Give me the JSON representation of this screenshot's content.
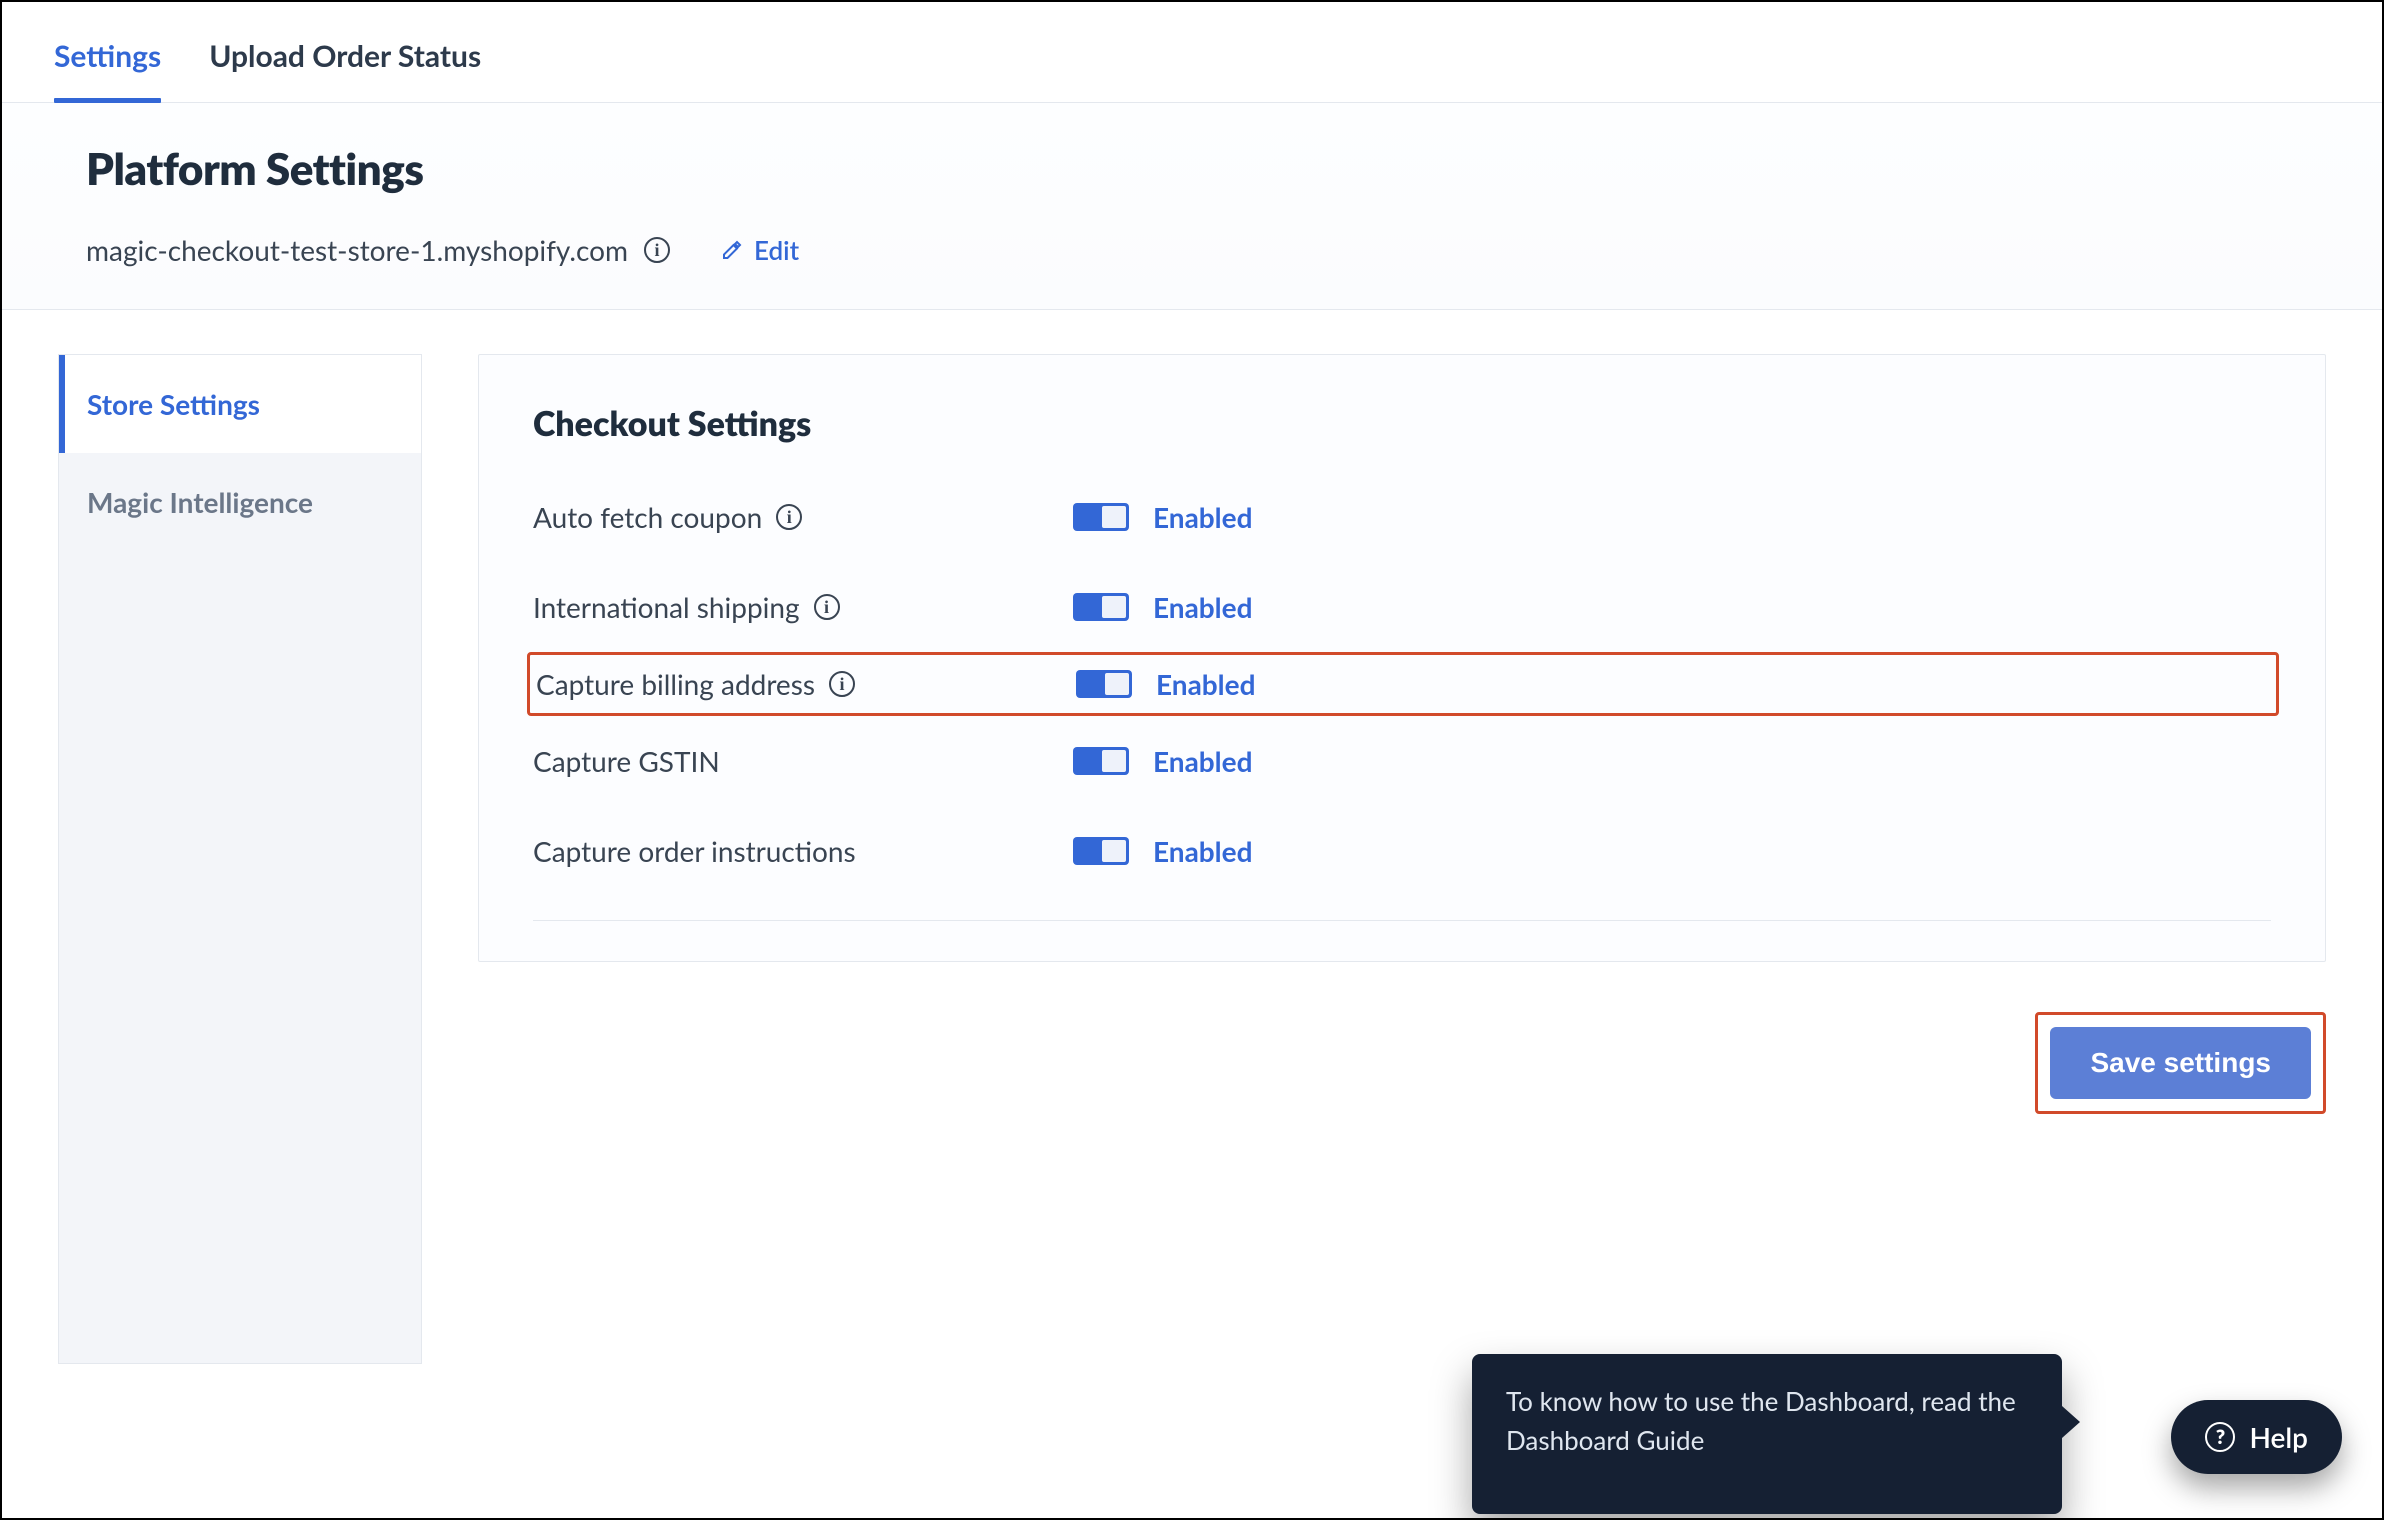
{
  "tabs": [
    {
      "label": "Settings",
      "active": true
    },
    {
      "label": "Upload Order Status",
      "active": false
    }
  ],
  "header": {
    "title": "Platform Settings",
    "store_url": "magic-checkout-test-store-1.myshopify.com",
    "edit_label": "Edit"
  },
  "sidebar": {
    "items": [
      {
        "label": "Store Settings",
        "active": true
      },
      {
        "label": "Magic Intelligence",
        "active": false
      }
    ]
  },
  "checkout": {
    "title": "Checkout Settings",
    "enabled_label": "Enabled",
    "rows": [
      {
        "label": "Auto fetch coupon",
        "info": true,
        "enabled": true,
        "highlight": false
      },
      {
        "label": "International shipping",
        "info": true,
        "enabled": true,
        "highlight": false
      },
      {
        "label": "Capture billing address",
        "info": true,
        "enabled": true,
        "highlight": true
      },
      {
        "label": "Capture GSTIN",
        "info": false,
        "enabled": true,
        "highlight": false
      },
      {
        "label": "Capture order instructions",
        "info": false,
        "enabled": true,
        "highlight": false
      }
    ]
  },
  "actions": {
    "save_label": "Save settings"
  },
  "tooltip": {
    "text": "To know how to use the Dashboard, read the Dashboard Guide"
  },
  "help": {
    "label": "Help"
  }
}
